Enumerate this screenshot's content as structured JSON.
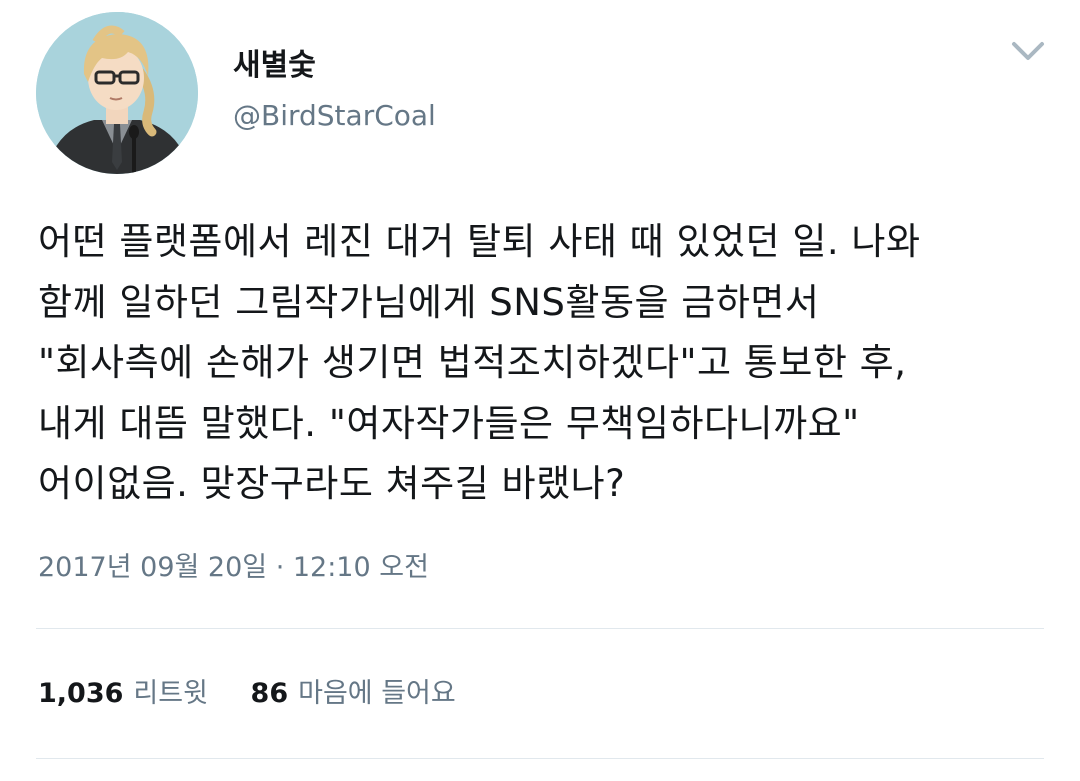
{
  "user": {
    "display_name": "새별숯",
    "handle": "@BirdStarCoal",
    "avatar_icon": "profile-avatar"
  },
  "menu": {
    "icon": "chevron-down-icon"
  },
  "tweet": {
    "lines": [
      "어떤 플랫폼에서 레진 대거 탈퇴 사태 때 있었던 일. 나와",
      "함께 일하던 그림작가님에게 SNS활동을 금하면서",
      "\"회사측에 손해가 생기면 법적조치하겠다\"고 통보한 후,",
      "내게 대뜸 말했다. \"여자작가들은 무책임하다니까요\"",
      "어이없음. 맞장구라도 쳐주길 바랬나?"
    ],
    "timestamp": "2017년 09월 20일 · 12:10 오전"
  },
  "stats": {
    "retweets_count": "1,036",
    "retweets_label": "리트윗",
    "likes_count": "86",
    "likes_label": "마음에 들어요"
  },
  "colors": {
    "text": "#14171a",
    "secondary": "#657786",
    "divider": "#e1e8ed",
    "avatar_bg": "#a9d3dc",
    "chevron": "#aab8c2"
  }
}
